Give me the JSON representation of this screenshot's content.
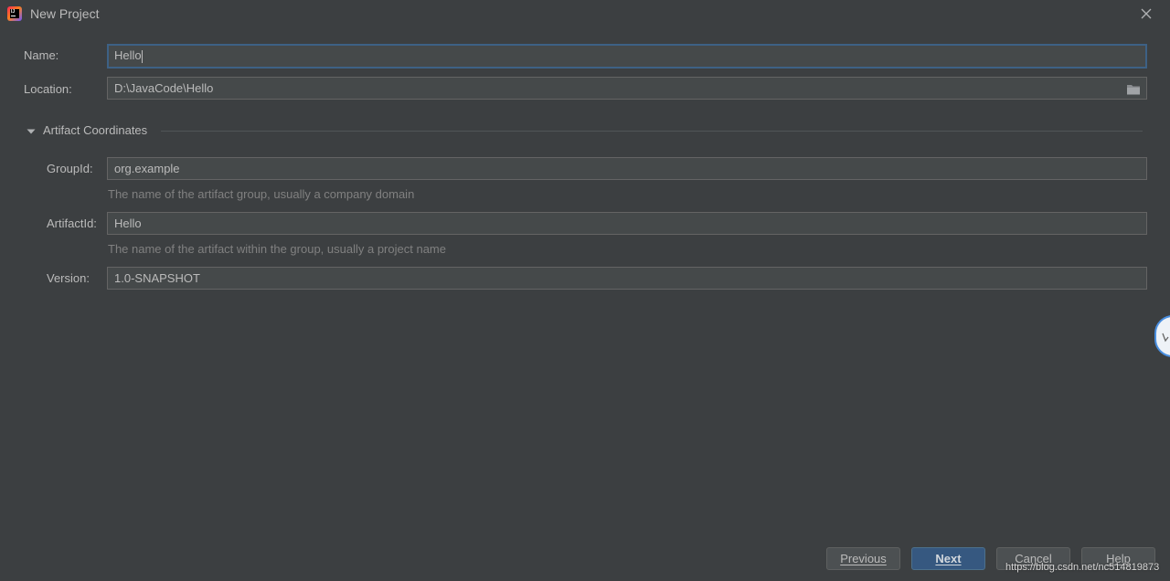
{
  "window": {
    "title": "New Project",
    "icon": "intellij-idea-icon",
    "close_icon": "close-icon"
  },
  "form": {
    "name_label": "Name:",
    "name_value": "Hello",
    "location_label": "Location:",
    "location_value": "D:\\JavaCode\\Hello",
    "location_browse_icon": "folder-icon"
  },
  "artifact": {
    "section_title": "Artifact Coordinates",
    "expanded": true,
    "group_id_label": "GroupId:",
    "group_id_value": "org.example",
    "group_id_hint": "The name of the artifact group, usually a company domain",
    "artifact_id_label": "ArtifactId:",
    "artifact_id_value": "Hello",
    "artifact_id_hint": "The name of the artifact within the group, usually a project name",
    "version_label": "Version:",
    "version_value": "1.0-SNAPSHOT"
  },
  "buttons": {
    "previous": "Previous",
    "next": "Next",
    "cancel": "Cancel",
    "help": "Help"
  },
  "watermark": "https://blog.csdn.net/nc514819873",
  "colors": {
    "background": "#3c3f41",
    "field_background": "#45494a",
    "focus_border": "#3d6185",
    "primary_button": "#365880"
  }
}
